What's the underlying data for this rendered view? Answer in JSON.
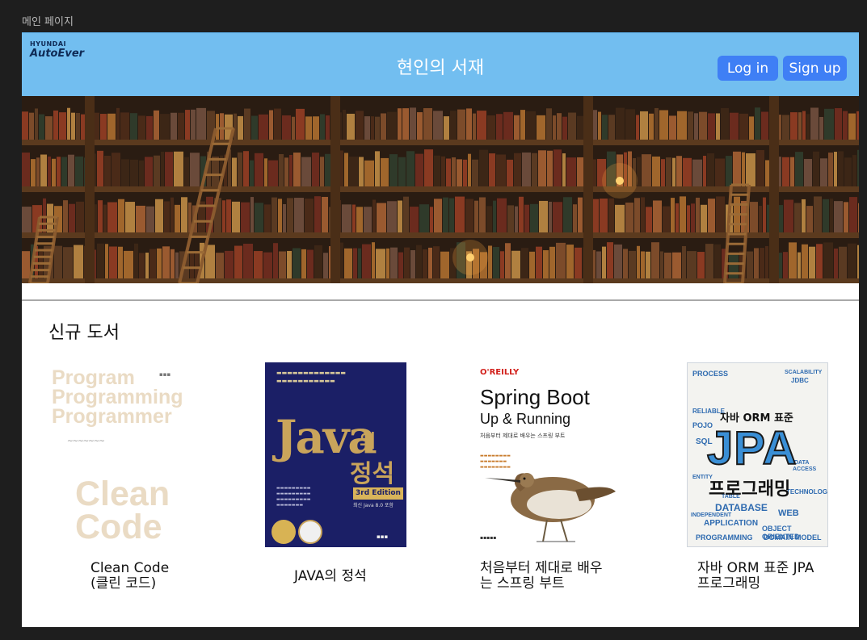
{
  "window": {
    "title": "메인 페이지"
  },
  "header": {
    "logo_top": "HYUNDAI",
    "logo_main": "AutoEver",
    "site_title": "현인의 서재",
    "login_label": "Log in",
    "signup_label": "Sign up"
  },
  "section": {
    "title": "신규 도서"
  },
  "books": [
    {
      "title_line1": "Clean Code",
      "title_line2": "(클린 코드)",
      "cover": {
        "line1": "Program",
        "line2": "Programming",
        "line3": "Programmer",
        "big1": "Clean",
        "big2": "Code"
      }
    },
    {
      "title_line1": "JAVA의 정석",
      "title_line2": "",
      "cover": {
        "java": "Java",
        "ui": "의",
        "jung": "정석",
        "edition": "3rd Edition",
        "sub": "최신 Java 8.0 포함"
      }
    },
    {
      "title_line1": "처음부터 제대로 배우",
      "title_line2": "는 스프링 부트",
      "cover": {
        "publisher": "O'REILLY",
        "t1": "Spring Boot",
        "t2": "Up & Running",
        "t3": "처음부터 제대로 배우는 스프링 부트"
      }
    },
    {
      "title_line1": "자바 ORM 표준 JPA",
      "title_line2": "프로그래밍",
      "cover": {
        "orm": "자바 ORM 표준",
        "big": "JPA",
        "prog": "프로그래밍"
      }
    }
  ]
}
